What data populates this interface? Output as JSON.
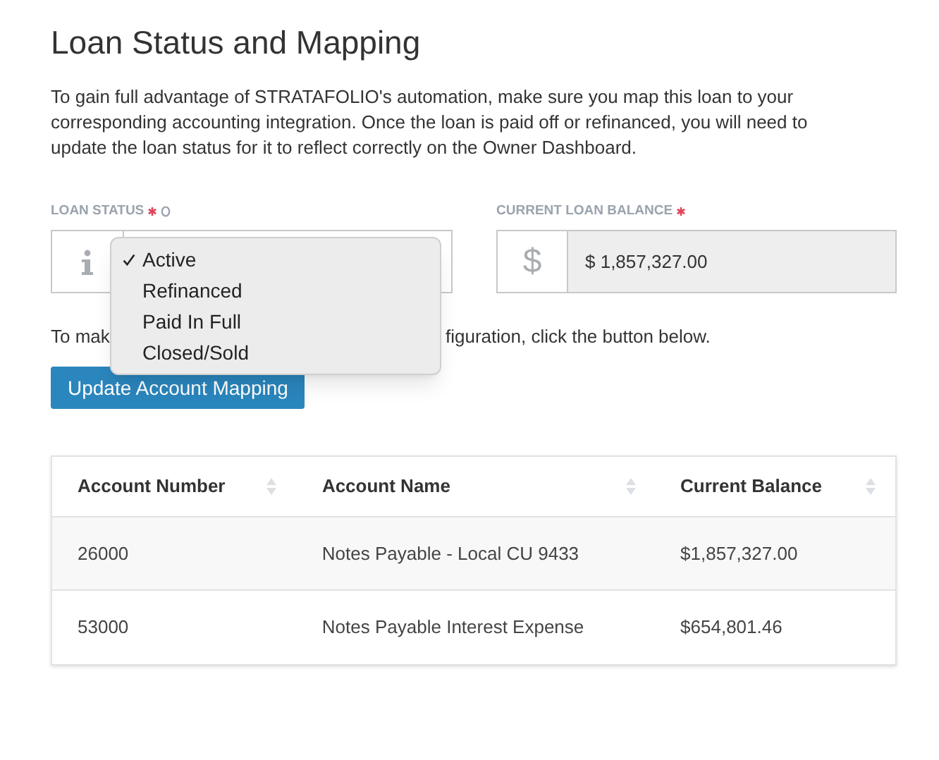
{
  "heading": "Loan Status and Mapping",
  "intro": "To gain full advantage of STRATAFOLIO's automation, make sure you map this loan to your corresponding accounting integration. Once the loan is paid off or refinanced, you will need to update the loan status for it to reflect correctly on the Owner Dashboard.",
  "loan_status": {
    "label": "LOAN STATUS",
    "required": true,
    "options": [
      {
        "label": "Active",
        "selected": true
      },
      {
        "label": "Refinanced",
        "selected": false
      },
      {
        "label": "Paid In Full",
        "selected": false
      },
      {
        "label": "Closed/Sold",
        "selected": false
      }
    ]
  },
  "current_loan_balance": {
    "label": "CURRENT LOAN BALANCE",
    "required": true,
    "prefix": "$",
    "value": "$ 1,857,327.00"
  },
  "mapping_note": {
    "start": "To mak",
    "end": "figuration, click the button below."
  },
  "update_button": "Update Account Mapping",
  "table": {
    "columns": [
      "Account Number",
      "Account Name",
      "Current Balance"
    ],
    "rows": [
      [
        "26000",
        "Notes Payable - Local CU 9433",
        "$1,857,327.00"
      ],
      [
        "53000",
        "Notes Payable Interest Expense",
        "$654,801.46"
      ]
    ]
  }
}
